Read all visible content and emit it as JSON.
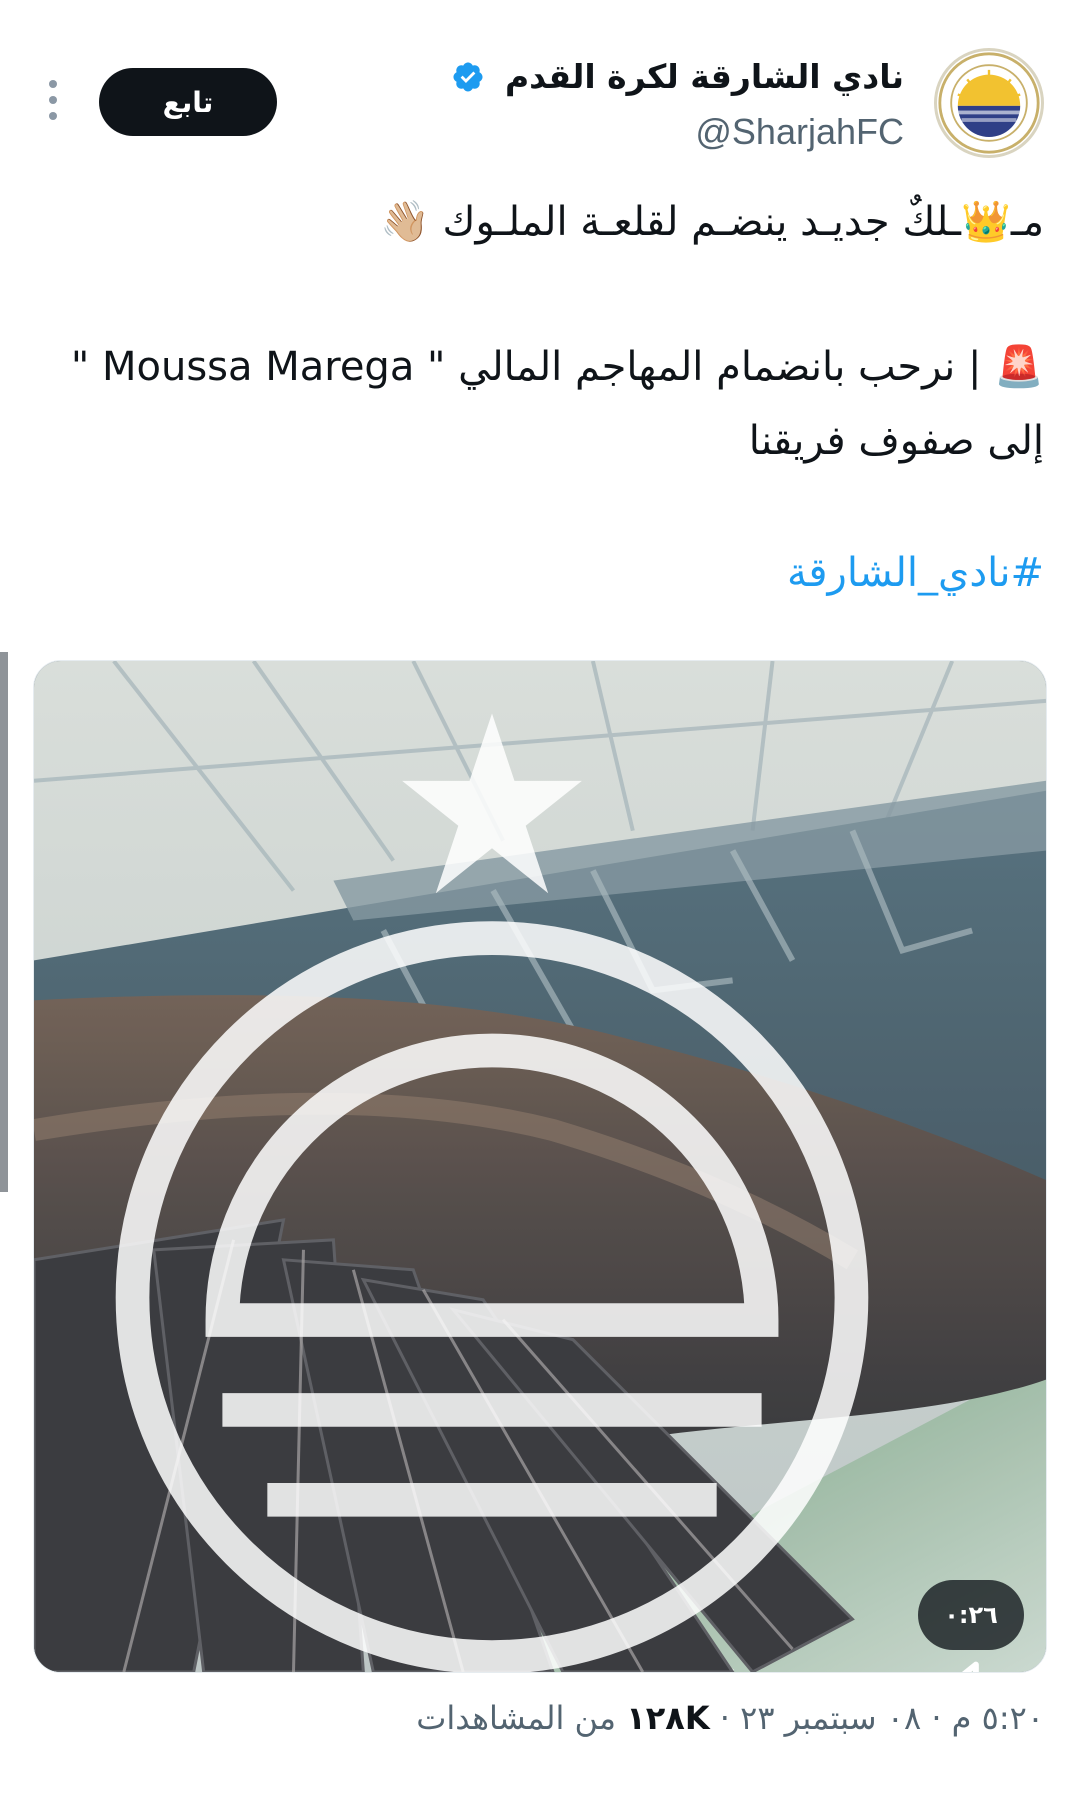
{
  "author": {
    "display_name": "نادي الشارقة لكرة القدم",
    "handle": "@SharjahFC",
    "avatar_icon": "sharjah-fc-logo",
    "verified": true,
    "verified_color": "#1d9bf0"
  },
  "actions": {
    "follow_label": "تابع",
    "more_icon": "more-options-icon"
  },
  "tweet": {
    "line1_prefix": "مـ",
    "line1_emoji_crown": "👑",
    "line1_text": "ـلكٌ جديـد ينضـم لقلعـة الملـوك",
    "line1_emoji_wave": "👋🏼",
    "line2_emoji_siren": "🚨",
    "line2_text": "| نرحب بانضمام المهاجم المالي  \" Moussa Marega \" إلى صفوف فريقنا",
    "hashtag": "#نادي_الشارقة"
  },
  "media": {
    "type": "video",
    "duration": "٠:٢٦",
    "muted": true,
    "watermark_icon": "sharjah-fc-watermark"
  },
  "meta": {
    "time": "٥:٢٠ م",
    "separator": "·",
    "date": "٠٨ سبتمبر ٢٣",
    "views_count": "١٢٨K",
    "views_label": "من المشاهدات"
  },
  "colors": {
    "text_primary": "#0f1419",
    "text_secondary": "#536471",
    "link": "#1d9bf0",
    "button_bg": "#0f1419"
  }
}
